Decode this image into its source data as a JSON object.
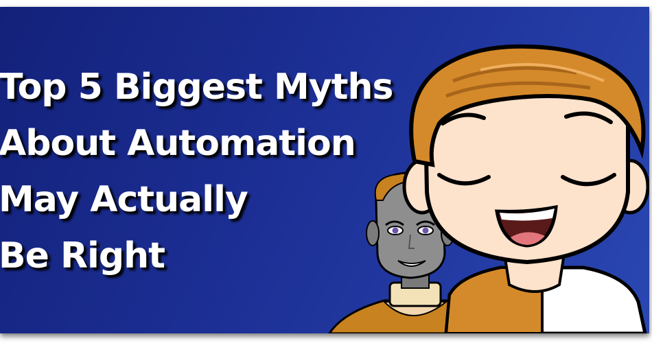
{
  "title": {
    "lines": [
      "Top 5 Biggest Myths",
      "About Automation",
      "May Actually",
      "Be Right"
    ]
  },
  "colors": {
    "background_dark": "#13217a",
    "background_light": "#2a47b2",
    "title_text": "#ffffff",
    "hair": "#d48a2a",
    "skin": "#fde2cc",
    "robot_face": "#8e8e8e"
  },
  "illustrations": [
    "robot-character",
    "smiling-boy-character"
  ]
}
